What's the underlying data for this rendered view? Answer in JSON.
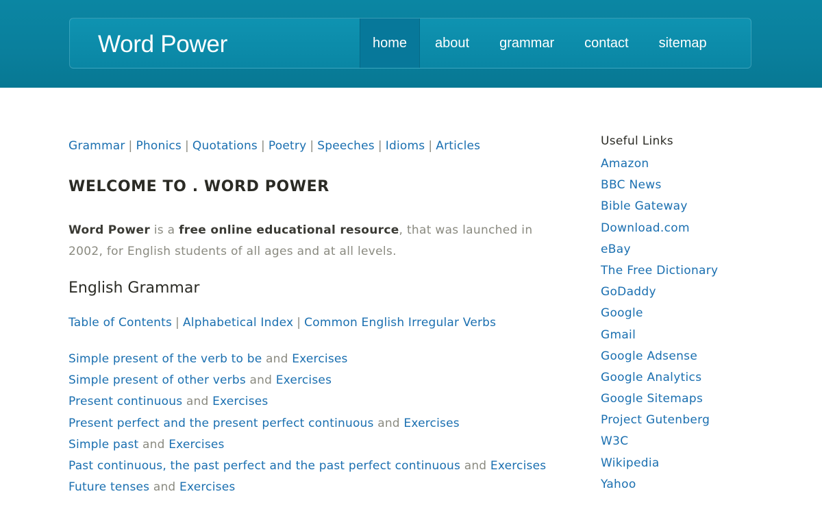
{
  "header": {
    "logo": "Word Power",
    "nav": [
      {
        "label": "home",
        "active": true
      },
      {
        "label": "about",
        "active": false
      },
      {
        "label": "grammar",
        "active": false
      },
      {
        "label": "contact",
        "active": false
      },
      {
        "label": "sitemap",
        "active": false
      }
    ]
  },
  "topnav": [
    "Grammar",
    "Phonics",
    "Quotations",
    "Poetry",
    "Speeches",
    "Idioms",
    "Articles"
  ],
  "welcome_title": "WELCOME TO . WORD POWER",
  "intro": {
    "brand": "Word Power",
    "is_a": " is a ",
    "highlight": "free online educational resource",
    "rest": ", that was launched in 2002, for English students of all ages and at all levels."
  },
  "grammar": {
    "heading": "English Grammar",
    "links": [
      "Table of Contents",
      "Alphabetical Index",
      "Common English Irregular Verbs"
    ],
    "connector": "and",
    "lessons": [
      {
        "topic": "Simple present of the verb to be",
        "exercise": "Exercises"
      },
      {
        "topic": "Simple present of other verbs",
        "exercise": "Exercises"
      },
      {
        "topic": "Present continuous",
        "exercise": "Exercises"
      },
      {
        "topic": "Present perfect and the present perfect continuous",
        "exercise": "Exercises"
      },
      {
        "topic": "Simple past",
        "exercise": "Exercises"
      },
      {
        "topic": "Past continuous, the past perfect and the past perfect continuous",
        "exercise": "Exercises"
      },
      {
        "topic": "Future tenses",
        "exercise": "Exercises"
      }
    ]
  },
  "sidebar": {
    "title": "Useful Links",
    "links": [
      "Amazon",
      "BBC News",
      "Bible Gateway",
      "Download.com",
      "eBay",
      "The Free Dictionary",
      "GoDaddy",
      "Google",
      "Gmail",
      "Google Adsense",
      "Google Analytics",
      "Google Sitemaps",
      "Project Gutenberg",
      "W3C",
      "Wikipedia",
      "Yahoo"
    ]
  },
  "colors": {
    "header_bg": "#0a7f9c",
    "link": "#1a6fb0",
    "muted_text": "#8a8a80",
    "heading_text": "#2b2b25"
  }
}
